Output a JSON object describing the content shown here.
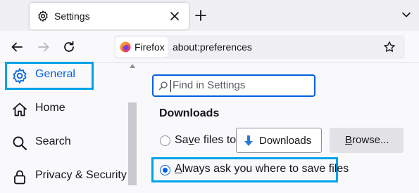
{
  "tab": {
    "title": "Settings"
  },
  "navbar": {
    "identity_label": "Firefox",
    "url": "about:preferences"
  },
  "sidebar": {
    "items": [
      {
        "label": "General",
        "selected": true,
        "icon": "gear-icon"
      },
      {
        "label": "Home",
        "selected": false,
        "icon": "home-icon"
      },
      {
        "label": "Search",
        "selected": false,
        "icon": "search-icon"
      },
      {
        "label": "Privacy & Security",
        "selected": false,
        "icon": "lock-icon"
      }
    ]
  },
  "main": {
    "search_placeholder": "Find in Settings",
    "section_title": "Downloads",
    "save_files": {
      "prefix": "Sa",
      "mnemonic": "v",
      "suffix": "e files to",
      "checked": false
    },
    "folder_button": "Downloads",
    "browse_button": {
      "mnemonic": "B",
      "suffix": "rowse..."
    },
    "always_ask": {
      "mnemonic": "A",
      "suffix": "lways ask you where to save files",
      "checked": true
    }
  },
  "colors": {
    "accent": "#0061e0",
    "highlight_box": "#00a2e8",
    "download_arrow": "#2a7ad5"
  }
}
